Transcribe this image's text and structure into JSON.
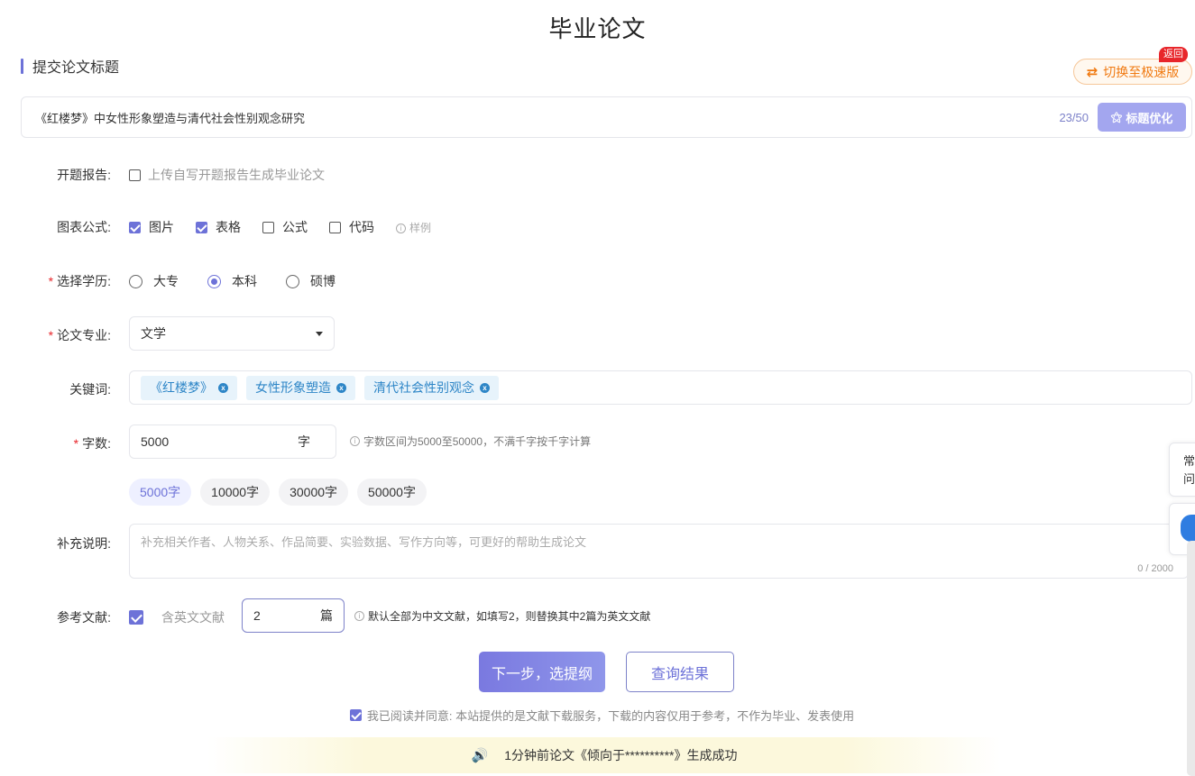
{
  "page": {
    "title": "毕业论文"
  },
  "section": {
    "title": "提交论文标题"
  },
  "switch": {
    "label": "切换至极速版",
    "icon": "swap-icon",
    "badge": "返回"
  },
  "title_input": {
    "value": "《红楼梦》中女性形象塑造与清代社会性别观念研究",
    "count": "23/50",
    "optimize_label": "标题优化"
  },
  "proposal": {
    "label": "开题报告:",
    "checkbox_label": "上传自写开题报告生成毕业论文",
    "checked": false
  },
  "charts": {
    "label": "图表公式:",
    "options": [
      {
        "label": "图片",
        "checked": true
      },
      {
        "label": "表格",
        "checked": true
      },
      {
        "label": "公式",
        "checked": false
      },
      {
        "label": "代码",
        "checked": false
      }
    ],
    "sample": "样例"
  },
  "degree": {
    "label": "选择学历:",
    "options": [
      {
        "label": "大专",
        "selected": false
      },
      {
        "label": "本科",
        "selected": true
      },
      {
        "label": "硕博",
        "selected": false
      }
    ]
  },
  "major": {
    "label": "论文专业:",
    "value": "文学"
  },
  "keywords": {
    "label": "关键词:",
    "tags": [
      "《红楼梦》",
      "女性形象塑造",
      "清代社会性别观念"
    ]
  },
  "words": {
    "label": "字数:",
    "value": "5000",
    "unit": "字",
    "hint": "字数区间为5000至50000，不满千字按千字计算",
    "presets": [
      "5000字",
      "10000字",
      "30000字",
      "50000字"
    ],
    "active_preset": "5000字"
  },
  "notes": {
    "label": "补充说明:",
    "placeholder": "补充相关作者、人物关系、作品简要、实验数据、写作方向等，可更好的帮助生成论文",
    "count": "0 / 2000"
  },
  "references": {
    "label": "参考文献:",
    "checkbox_label": "含英文文献",
    "checked": true,
    "value": "2",
    "unit": "篇",
    "hint": "默认全部为中文文献，如填写2，则替换其中2篇为英文文献"
  },
  "actions": {
    "next_label": "下一步，选提纲",
    "query_label": "查询结果"
  },
  "agree": {
    "text": "我已阅读并同意: 本站提供的是文献下载服务，下载的内容仅用于参考，不作为毕业、发表使用",
    "checked": true
  },
  "notice": {
    "text": "1分钟前论文《倾向于**********》生成成功",
    "icon": "speaker-icon"
  },
  "side": {
    "faq_line1": "常",
    "faq_line2": "问"
  },
  "colors": {
    "accent": "#6d72d8",
    "tag_text": "#2e86c7",
    "warning": "#f07a12",
    "badge": "#e8262b"
  }
}
